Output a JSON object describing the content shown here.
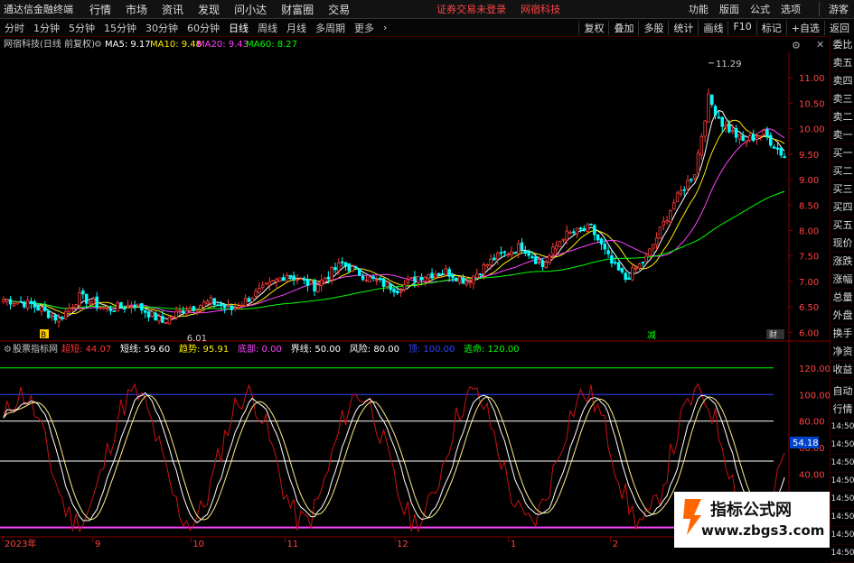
{
  "menubar": {
    "brand": "通达信金融终端",
    "menus": [
      "行情",
      "市场",
      "资讯",
      "发现",
      "问小达",
      "财富圈",
      "交易"
    ],
    "notice": "证券交易未登录",
    "stock_name": "网宿科技",
    "right": [
      "功能",
      "版面",
      "公式",
      "选项"
    ],
    "guest": "游客"
  },
  "periodbar": {
    "periods": [
      "分时",
      "1分钟",
      "5分钟",
      "15分钟",
      "30分钟",
      "60分钟",
      "日线",
      "周线",
      "月线",
      "多周期",
      "更多"
    ],
    "active": "日线",
    "tools": [
      "复权",
      "叠加",
      "多股",
      "统计",
      "画线",
      "F10",
      "标记",
      "+自选",
      "返回"
    ]
  },
  "main_chart": {
    "header": {
      "title": "网宿科技(日线 前复权)",
      "ma5": "MA5: 9.17",
      "ma10": "MA10: 9.48",
      "ma20": "MA20: 9.43",
      "ma60": "MA60: 8.27"
    },
    "ma_colors": {
      "ma5": "#ffffff",
      "ma10": "#ffee00",
      "ma20": "#ff44ff",
      "ma60": "#00ff00"
    },
    "up_color": "#ff3c3c",
    "down_color": "#00ffff",
    "high_label": "11.29",
    "low_label": "6.01",
    "y_ticks": [
      11.0,
      10.5,
      10.0,
      9.5,
      9.0,
      8.5,
      8.0,
      7.5,
      7.0,
      6.5,
      6.0
    ],
    "y_range": [
      5.9,
      11.5
    ],
    "markers": {
      "left": "B",
      "mid": "减",
      "right": "财"
    }
  },
  "indicator": {
    "title": "股票指标网",
    "items": [
      {
        "label": "超短",
        "value": "44.07",
        "color": "#ff3333"
      },
      {
        "label": "短线",
        "value": "59.60",
        "color": "#ffffff"
      },
      {
        "label": "趋势",
        "value": "95.91",
        "color": "#ffee00"
      },
      {
        "label": "底部",
        "value": "0.00",
        "color": "#ff44ff"
      },
      {
        "label": "界线",
        "value": "50.00",
        "color": "#ffffff"
      },
      {
        "label": "风险",
        "value": "80.00",
        "color": "#ffffff"
      },
      {
        "label": "顶",
        "value": "100.00",
        "color": "#3344ff"
      },
      {
        "label": "逃命",
        "value": "120.00",
        "color": "#00ff00"
      }
    ],
    "y_ticks": [
      120,
      100,
      80,
      60,
      40
    ],
    "y_range": [
      -5,
      128
    ],
    "current_value": "54.18",
    "levels": [
      {
        "value": 120,
        "color": "#00ff00"
      },
      {
        "value": 100,
        "color": "#3344ff"
      },
      {
        "value": 80,
        "color": "#ffffff"
      },
      {
        "value": 50,
        "color": "#ffffff"
      },
      {
        "value": 0,
        "color": "#ff44ff"
      }
    ]
  },
  "x_axis": {
    "labels": [
      {
        "text": "2023年",
        "pos": 0.0
      },
      {
        "text": "9",
        "pos": 0.115
      },
      {
        "text": "10",
        "pos": 0.24
      },
      {
        "text": "11",
        "pos": 0.36
      },
      {
        "text": "12",
        "pos": 0.5
      },
      {
        "text": "1",
        "pos": 0.645
      },
      {
        "text": "2",
        "pos": 0.775
      }
    ]
  },
  "right_tabs": [
    "委比",
    "卖五",
    "卖四",
    "卖三",
    "卖二",
    "卖一",
    "买一",
    "买二",
    "买三",
    "买四",
    "买五",
    "现价",
    "涨跌",
    "涨幅",
    "总量",
    "外盘",
    "换手",
    "净资",
    "收益"
  ],
  "right_tabs_lower": [
    "自动",
    "行情",
    "14:50",
    "14:50",
    "14:50",
    "14:50",
    "14:50",
    "14:50",
    "14:50",
    "14:50"
  ],
  "watermark": {
    "line1": "指标公式网",
    "line2": "www.zbgs3.com"
  }
}
